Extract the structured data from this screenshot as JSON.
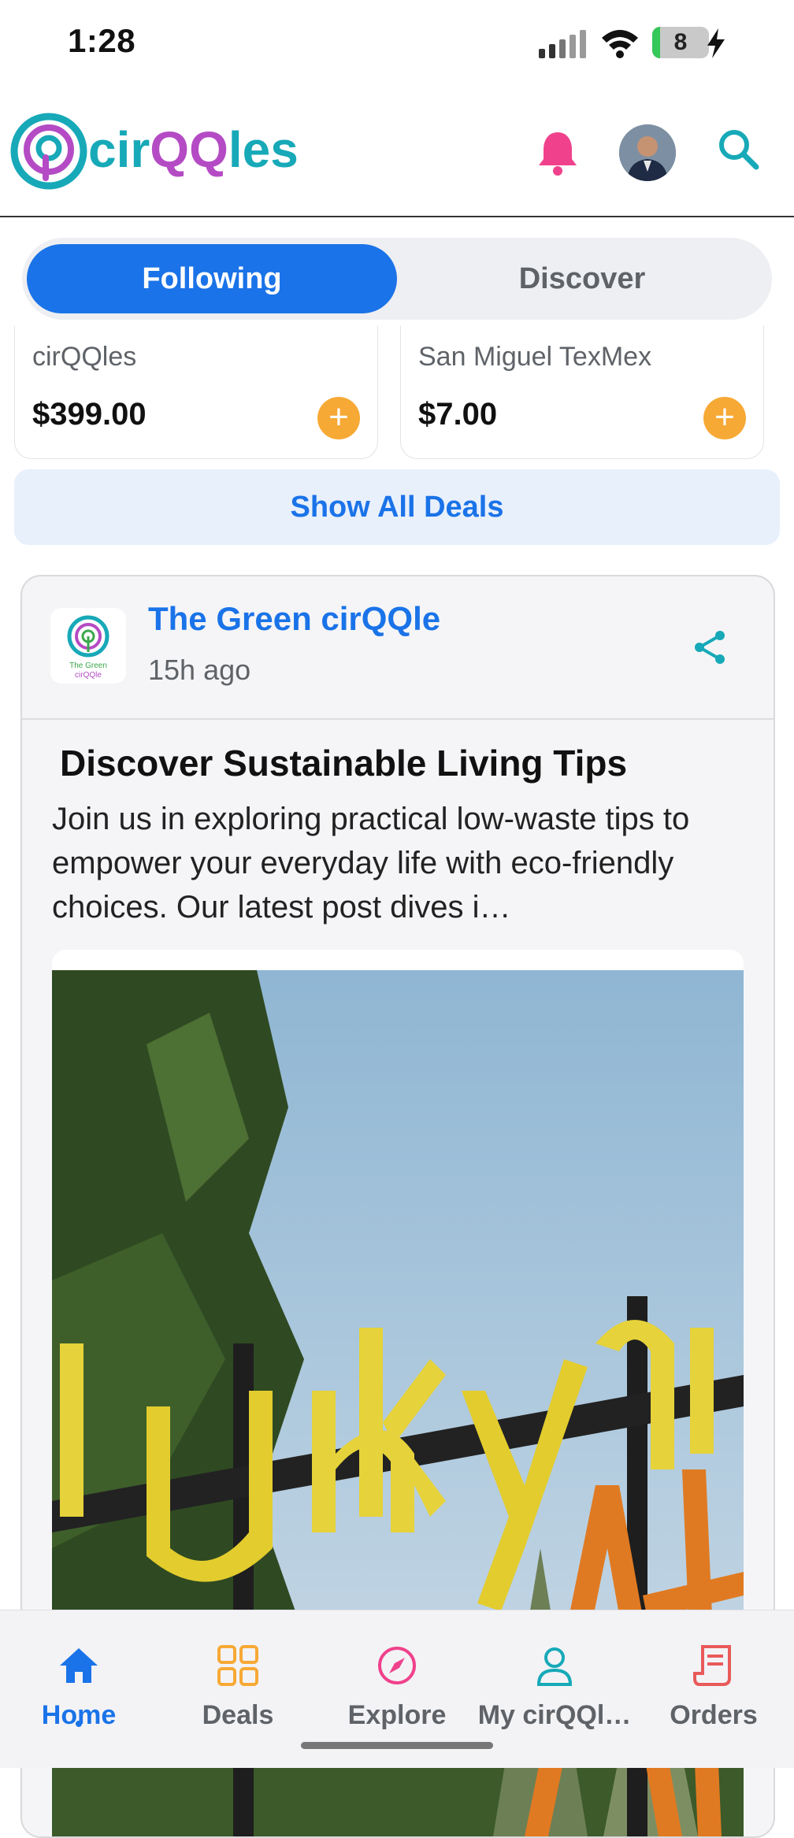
{
  "status_bar": {
    "time": "1:28",
    "battery": "8"
  },
  "header": {
    "logo_text_a": "cir",
    "logo_text_b": "QQ",
    "logo_text_c": "les",
    "colors": {
      "teal": "#17a9b8",
      "purple": "#b44bc4",
      "bell": "#f0428c"
    }
  },
  "tabs": [
    {
      "label": "Following",
      "active": true
    },
    {
      "label": "Discover",
      "active": false
    }
  ],
  "deals": [
    {
      "merchant": "cirQQles",
      "price": "$399.00"
    },
    {
      "merchant": "San Miguel TexMex",
      "price": "$7.00"
    }
  ],
  "show_all_label": "Show All Deals",
  "post": {
    "org_name": "The Green cirQQle",
    "logo_text_line1": "The Green",
    "logo_text_line2": "cirQQle",
    "time_ago": "15h ago",
    "title": "Discover Sustainable Living Tips",
    "body": "Join us in exploring practical low-waste tips to empower your everyday life with eco-friendly choices. Our latest post dives i…"
  },
  "nav": [
    {
      "label": "Home",
      "icon": "home-icon",
      "active": true
    },
    {
      "label": "Deals",
      "icon": "grid-icon"
    },
    {
      "label": "Explore",
      "icon": "compass-icon"
    },
    {
      "label": "My cirQQl…",
      "icon": "person-icon"
    },
    {
      "label": "Orders",
      "icon": "receipt-icon"
    }
  ],
  "accent_color": "#1a73e8"
}
